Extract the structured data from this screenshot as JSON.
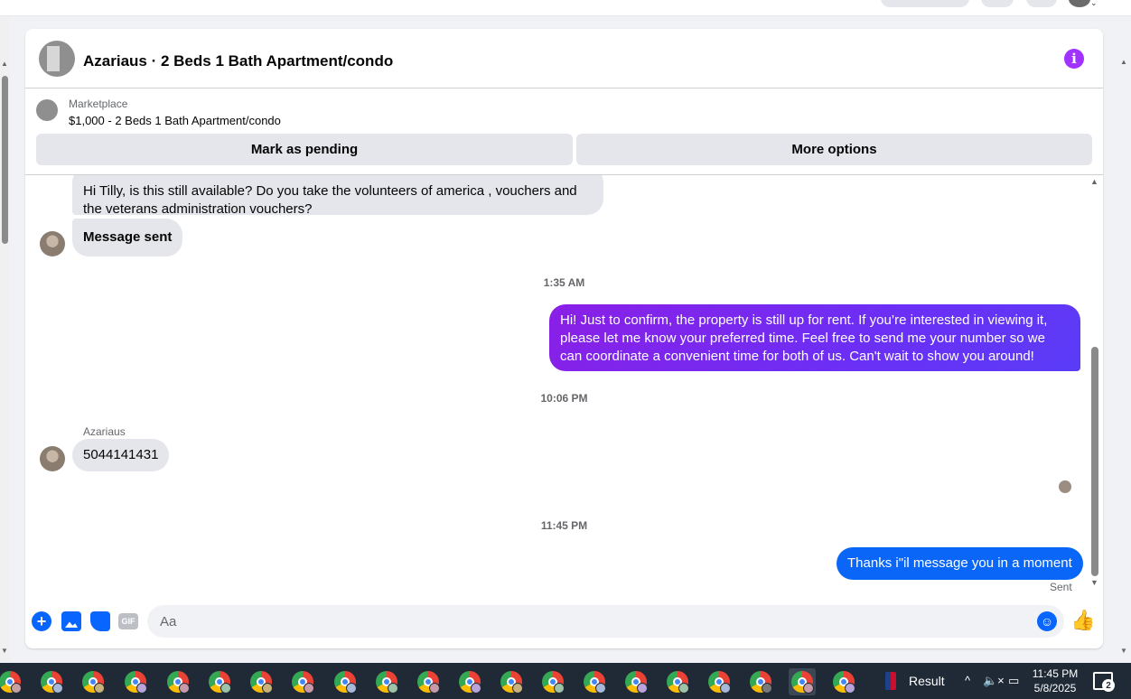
{
  "header": {
    "title": "Azariaus · 2 Beds 1 Bath Apartment/condo",
    "info_icon": "info-icon",
    "info_glyph": "i"
  },
  "listing": {
    "label": "Marketplace",
    "price_title": "$1,000 - 2 Beds 1 Bath Apartment/condo",
    "buttons": {
      "pending": "Mark as pending",
      "more": "More options"
    }
  },
  "messages": {
    "incoming_1": "Hi Tilly, is this still available? Do you take the volunteers of america , vouchers and the veterans administration vouchers?",
    "incoming_2": "Message sent",
    "timestamp_1": "1:35 AM",
    "outgoing_1": "Hi! Just to confirm, the property is still up for rent. If you’re interested in viewing it, please let me know your preferred time. Feel free to send me your number so we can coordinate a convenient time for both of us. Can't wait to show you around!",
    "timestamp_2": "10:06 PM",
    "sender_name": "Azariaus",
    "incoming_3": "5044141431",
    "timestamp_3": "11:45 PM",
    "outgoing_2": "Thanks i\"il message you in a moment",
    "sent_status": "Sent"
  },
  "composer": {
    "placeholder": "Aa",
    "plus_glyph": "+",
    "gif_label": "GIF",
    "emoji_glyph": "☺",
    "like_glyph": "👍"
  },
  "taskbar": {
    "result_label": "Result",
    "tray_caret": "^",
    "volume_glyph": "🔈×",
    "network_glyph": "▭",
    "time": "11:45 PM",
    "date": "5/8/2025",
    "notification_count": "2"
  },
  "colors": {
    "accent": "#0866ff",
    "outgoing_gradient_start": "#8b1fe6",
    "outgoing_gradient_end": "#5a3cf7",
    "info": "#a033ff"
  }
}
